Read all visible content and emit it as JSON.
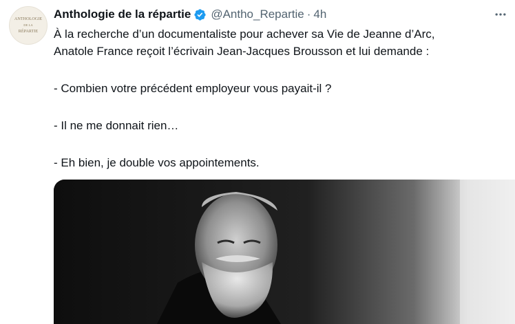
{
  "tweet": {
    "avatar": {
      "line1": "ANTHOLOGIE",
      "line2": "DE LA",
      "line3": "RÉPARTIE"
    },
    "author_name": "Anthologie de la répartie",
    "handle": "@Antho_Repartie",
    "separator": "·",
    "time": "4h",
    "verified_icon": "verified-badge-icon",
    "more_icon": "more-options-icon",
    "text": {
      "p1_line1": "À la recherche d’un documentaliste pour achever sa Vie de Jeanne d’Arc,",
      "p1_line2": "Anatole France reçoit l’écrivain Jean-Jacques Brousson et lui demande :",
      "p2": "- Combien votre précédent employeur vous payait-il ?",
      "p3": "- Il ne me donnait rien…",
      "p4": "- Eh bien, je double vos appointements."
    },
    "media_description": "photo-black-and-white-portrait"
  },
  "colors": {
    "text": "#0f1419",
    "secondary": "#536471",
    "verified": "#1d9bf0"
  }
}
